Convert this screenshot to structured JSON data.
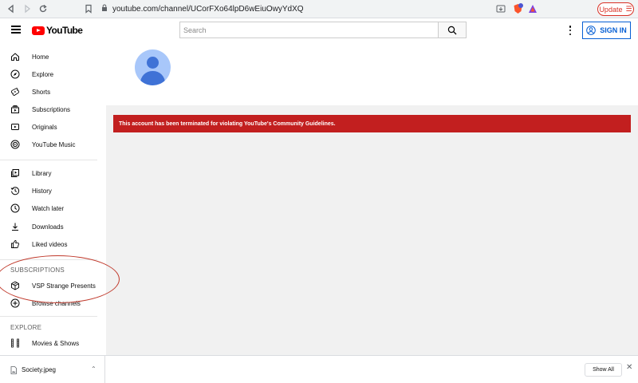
{
  "browser": {
    "url": "youtube.com/channel/UCorFXo64lpD6wEiuOwyYdXQ",
    "update_label": "Update",
    "colors": {
      "update": "#d93025",
      "toolbar": "#f1f3f4"
    },
    "icons": [
      "back-icon",
      "forward-icon",
      "reload-icon",
      "bookmark-icon",
      "lock-icon",
      "install-icon",
      "brave-shield-icon",
      "brave-rewards-icon",
      "menu-icon"
    ]
  },
  "header": {
    "logo_text": "YouTube",
    "search_placeholder": "Search",
    "signin_label": "SIGN IN",
    "colors": {
      "logo_red": "#ff0000",
      "signin_blue": "#065fd4"
    }
  },
  "sidebar": {
    "primary": [
      {
        "label": "Home",
        "icon": "home-icon"
      },
      {
        "label": "Explore",
        "icon": "compass-icon"
      },
      {
        "label": "Shorts",
        "icon": "shorts-icon"
      },
      {
        "label": "Subscriptions",
        "icon": "subscriptions-icon"
      },
      {
        "label": "Originals",
        "icon": "originals-icon"
      },
      {
        "label": "YouTube Music",
        "icon": "music-icon"
      }
    ],
    "library": [
      {
        "label": "Library",
        "icon": "library-icon"
      },
      {
        "label": "History",
        "icon": "history-icon"
      },
      {
        "label": "Watch later",
        "icon": "clock-icon"
      },
      {
        "label": "Downloads",
        "icon": "download-icon"
      },
      {
        "label": "Liked videos",
        "icon": "thumbs-up-icon"
      }
    ],
    "subscriptions_heading": "SUBSCRIPTIONS",
    "subscriptions": [
      {
        "label": "VSP Strange Presents",
        "icon": "cube-icon"
      },
      {
        "label": "Browse channels",
        "icon": "add-circle-icon"
      }
    ],
    "explore_heading": "EXPLORE",
    "explore": [
      {
        "label": "Movies & Shows",
        "icon": "film-icon"
      }
    ]
  },
  "main": {
    "banner_text": "This account has been terminated for violating YouTube's Community Guidelines.",
    "colors": {
      "banner": "#c21f1f",
      "background": "#f1f1f1",
      "avatar_light": "#a8c7fa",
      "avatar_dark": "#3f72d6"
    }
  },
  "annotation": {
    "color": "#c0392b",
    "shape": "ellipse",
    "target": "VSP Strange Presents"
  },
  "downloads_bar": {
    "file_name": "Society.jpeg",
    "show_all_label": "Show All"
  }
}
